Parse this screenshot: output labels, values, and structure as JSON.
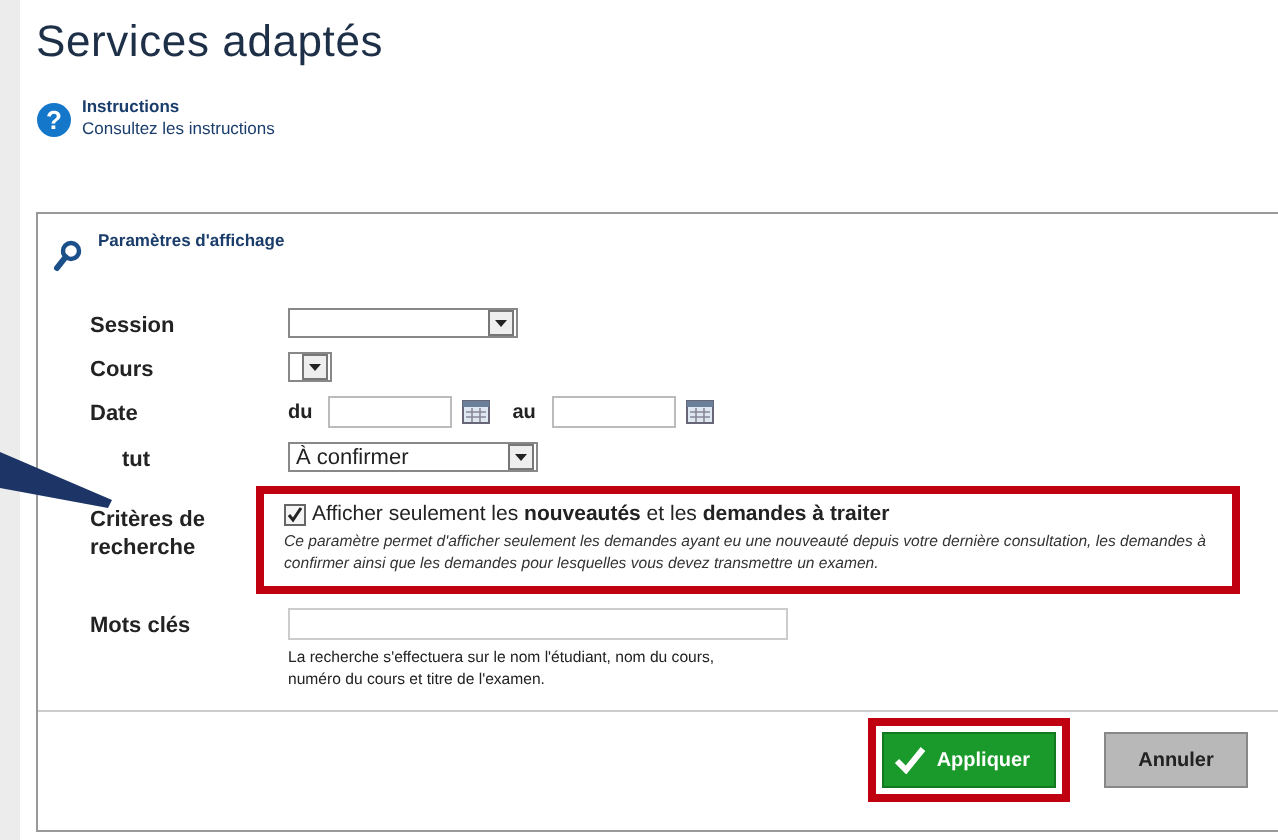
{
  "page": {
    "title": "Services adaptés"
  },
  "instructions": {
    "icon": "?",
    "title": "Instructions",
    "link": "Consultez les instructions"
  },
  "panel": {
    "title": "Paramètres d'affichage"
  },
  "fields": [
    {
      "kind": "select",
      "label": "Session"
    },
    {
      "kind": "compact-select",
      "label": "Cours"
    },
    {
      "kind": "daterange",
      "label": "Date",
      "from_label": "du",
      "to_label": "au"
    },
    {
      "kind": "select",
      "label": "tut",
      "value": "À confirmer"
    },
    {
      "kind": "checkbox",
      "label": "Critères de recherche",
      "checked": true,
      "text": "Afficher seulement les **nouveautés** et les **demandes à traiter**",
      "description": "Ce paramètre permet d'afficher seulement les demandes ayant eu une nouveauté depuis votre dernière consultation, les demandes à confirmer ainsi que les demandes pour lesquelles vous devez transmettre un examen."
    },
    {
      "kind": "text",
      "label": "Mots clés",
      "hint": "La recherche s'effectuera sur le nom l'étudiant, nom du cours, numéro du cours et titre de l'examen."
    }
  ],
  "buttons": [
    {
      "label": "Appliquer",
      "kind": "primary"
    },
    {
      "label": "Annuler",
      "kind": "secondary"
    }
  ]
}
